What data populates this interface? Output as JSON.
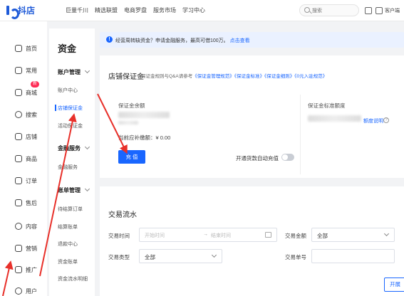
{
  "header": {
    "logo_text": "抖店",
    "nav": [
      "巨量千川",
      "精选联盟",
      "电商罗盘",
      "服务市场",
      "学习中心"
    ],
    "search_placeholder": "搜索",
    "service_label": "客户端"
  },
  "sidebar": {
    "items": [
      {
        "label": "首页",
        "icon": "home-icon"
      },
      {
        "label": "常用",
        "icon": "star-icon"
      },
      {
        "label": "商城",
        "icon": "mall-icon",
        "badge": "新"
      },
      {
        "label": "搜索",
        "icon": "search-icon"
      },
      {
        "label": "店铺",
        "icon": "shop-icon"
      },
      {
        "label": "商品",
        "icon": "goods-icon"
      },
      {
        "label": "订单",
        "icon": "order-icon"
      },
      {
        "label": "售后",
        "icon": "aftersale-icon"
      },
      {
        "label": "内容",
        "icon": "content-icon"
      },
      {
        "label": "营销",
        "icon": "marketing-icon"
      },
      {
        "label": "推广",
        "icon": "promote-icon"
      },
      {
        "label": "用户",
        "icon": "user-icon"
      }
    ]
  },
  "subsidebar": {
    "title": "资金",
    "groups": [
      {
        "label": "账户管理",
        "items": [
          "账户中心",
          "店铺保证金",
          "活动保证金"
        ]
      },
      {
        "label": "金融服务",
        "items": [
          "金融服务"
        ]
      },
      {
        "label": "账单管理",
        "items": [
          "待结算订单",
          "结算账单",
          "退款中心",
          "资金账单",
          "资金流水明细"
        ]
      }
    ],
    "active_item": "店铺保证金"
  },
  "notice": {
    "icon": "info-icon",
    "text": "经营周转缺资金？申请金融服务，最高可借100万。",
    "link": "点击查看"
  },
  "deposit": {
    "title": "店铺保证金",
    "subtitle": "保证金规则与Q&A请参考",
    "links": [
      "《保证金管理规范》",
      "《保证金标准》",
      "《保证金细则》",
      "《0元入驻规范》"
    ],
    "balance_label": "保证金余额",
    "due_label": "当前应补缴额：¥ 0.00",
    "recharge_button": "充 值",
    "auto_recharge_label": "开通货款自动充值",
    "auto_recharge_on": false,
    "standard_label": "保证金标准额度",
    "detail_link": "额度说明"
  },
  "flow": {
    "title": "交易流水",
    "time_label": "交易时间",
    "start_placeholder": "开始时间",
    "range_sep": "→",
    "end_placeholder": "结束时间",
    "amount_label": "交易金额",
    "amount_value": "全部",
    "type_label": "交易类型",
    "type_value": "全部",
    "order_label": "交易单号",
    "expand_button": "开展"
  },
  "colors": {
    "primary": "#1966ff",
    "annotation_arrow": "#e8302a",
    "badge": "#fe2c55"
  }
}
